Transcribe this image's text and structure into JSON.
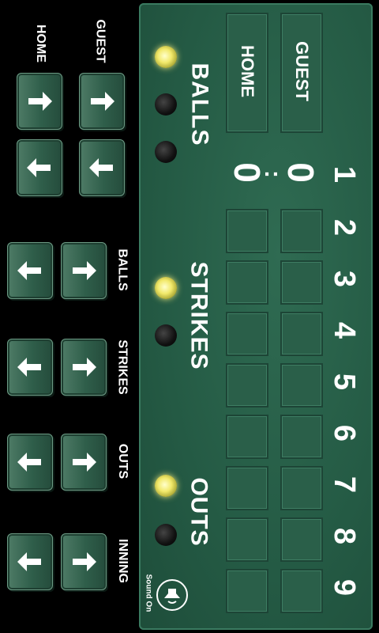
{
  "controls": {
    "home_label": "HOME",
    "guest_label": "GUEST",
    "balls_label": "BALLS",
    "strikes_label": "STRIKES",
    "outs_label": "OUTS",
    "inning_label": "INNING"
  },
  "scoreboard": {
    "home_header": "HOME",
    "guest_header": "GUEST",
    "home_score": "0",
    "guest_score": "0",
    "score_separator": ":",
    "balls_label": "BALLS",
    "strikes_label": "STRIKES",
    "outs_label": "OUTS",
    "innings": [
      "1",
      "2",
      "3",
      "4",
      "5",
      "6",
      "7",
      "8",
      "9"
    ],
    "balls_count": 1,
    "strikes_count": 1,
    "outs_count": 1
  },
  "sound": {
    "label": "Sound On",
    "icon": "speaker-icon"
  },
  "colors": {
    "board_green": "#245a44",
    "button_green": "#2f5e4a",
    "lamp_on": "#f2e96a",
    "lamp_off": "#111111"
  }
}
